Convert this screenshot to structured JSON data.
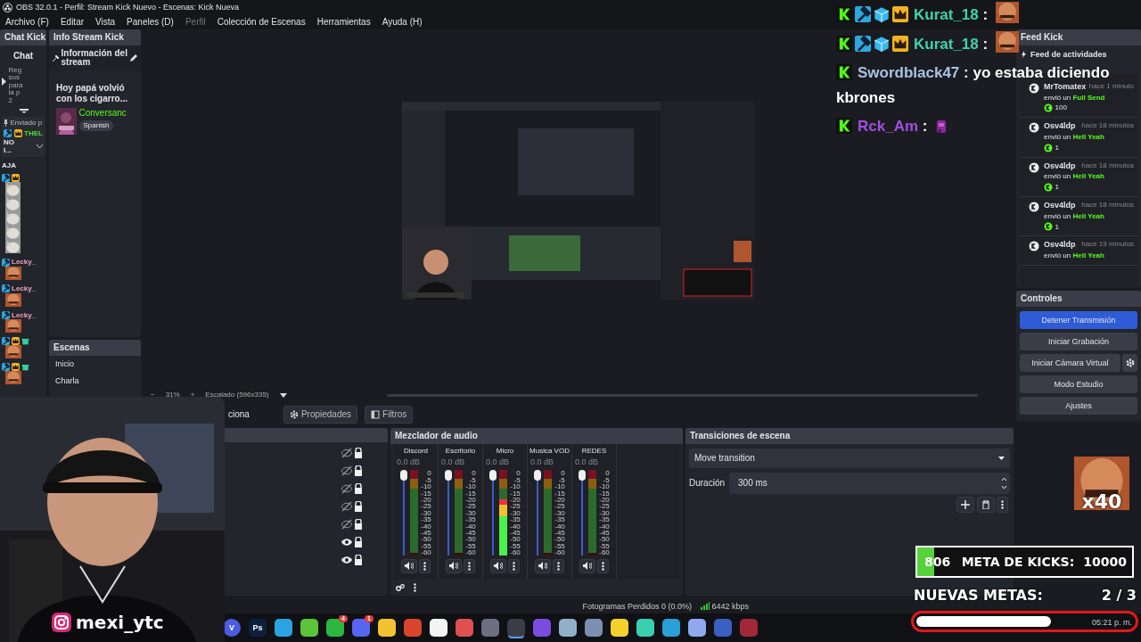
{
  "window": {
    "title": "OBS 32.0.1 - Perfil: Stream Kick Nuevo - Escenas: Kick Nueva"
  },
  "menu": [
    {
      "label": "Archivo (F)",
      "disabled": false
    },
    {
      "label": "Editar",
      "disabled": false
    },
    {
      "label": "Vista",
      "disabled": false
    },
    {
      "label": "Paneles (D)",
      "disabled": false
    },
    {
      "label": "Perfil",
      "disabled": true
    },
    {
      "label": "Colección de Escenas",
      "disabled": false
    },
    {
      "label": "Herramientas",
      "disabled": false
    },
    {
      "label": "Ayuda (H)",
      "disabled": false
    }
  ],
  "chat_dock": {
    "title": "Chat Kick",
    "header": "Chat",
    "notice": "Reg sus para la p 2",
    "pinned": {
      "label": "Enviado p",
      "badges": [
        {
          "kind": "moderator"
        },
        {
          "kind": "crown"
        }
      ],
      "user": "THEL",
      "color": "#4ade30",
      "text": "NO I..."
    },
    "messages": [
      {
        "text": "AJA"
      },
      {
        "badges": [
          {
            "kind": "moderator"
          },
          {
            "kind": "crown"
          }
        ],
        "emotes": [
          {
            "kind": "picture"
          },
          {
            "kind": "picture"
          },
          {
            "kind": "picture"
          },
          {
            "kind": "picture"
          },
          {
            "kind": "picture"
          }
        ]
      },
      {
        "badges": [
          {
            "kind": "moderator"
          }
        ],
        "user": "Lecky_",
        "color": "#f0a0c0",
        "emotes": [
          {
            "kind": "picture"
          }
        ]
      },
      {
        "badges": [
          {
            "kind": "moderator"
          }
        ],
        "user": "Lecky_",
        "color": "#f0a0c0",
        "emotes": [
          {
            "kind": "picture"
          }
        ]
      },
      {
        "badges": [
          {
            "kind": "moderator"
          }
        ],
        "user": "Lecky_",
        "color": "#f0a0c0",
        "emotes": [
          {
            "kind": "picture"
          }
        ]
      },
      {
        "badges": [
          {
            "kind": "moderator"
          },
          {
            "kind": "crown"
          },
          {
            "kind": "gift"
          }
        ],
        "emotes": [
          {
            "kind": "picture"
          }
        ]
      },
      {
        "badges": [
          {
            "kind": "moderator"
          },
          {
            "kind": "crown"
          },
          {
            "kind": "gift"
          }
        ],
        "emotes": [
          {
            "kind": "picture"
          }
        ]
      }
    ]
  },
  "info_dock": {
    "title": "Info Stream Kick",
    "header": "Información del stream",
    "stream_title": "Hoy papá volvió con los cigarro...",
    "category": "Conversanc",
    "language": "Spanish"
  },
  "scenes": {
    "title": "Escenas",
    "items": [
      {
        "label": "Inicio",
        "selected": false
      },
      {
        "label": "Charla",
        "selected": false
      }
    ]
  },
  "preview_toolbar": {
    "zoom_out": "−",
    "zoom": "31%",
    "zoom_in": "+",
    "scale": "Escalado (596x335)"
  },
  "source_toolbar": {
    "label": "ciona",
    "properties": "Propiedades",
    "filters": "Filtros"
  },
  "sources": [
    {
      "visible": false,
      "locked": true
    },
    {
      "visible": false,
      "locked": true
    },
    {
      "visible": false,
      "locked": true
    },
    {
      "visible": false,
      "locked": true
    },
    {
      "visible": false,
      "locked": true
    },
    {
      "visible": true,
      "locked": true
    },
    {
      "visible": true,
      "locked": true
    }
  ],
  "mixer": {
    "title": "Mezclador de audio",
    "channels": [
      {
        "name": "Discord",
        "reading": "0.0 dB",
        "level": 1,
        "meter": {
          "level": 0
        },
        "scale": [
          "0",
          "-5",
          "-10",
          "-15",
          "-20",
          "-25",
          "-30",
          "-35",
          "-40",
          "-45",
          "-50",
          "-55",
          "-60"
        ]
      },
      {
        "name": "Escritorio",
        "reading": "0.0 dB",
        "level": 1,
        "meter": {
          "level": 0
        },
        "scale": [
          "0",
          "-5",
          "-10",
          "-15",
          "-20",
          "-25",
          "-30",
          "-35",
          "-40",
          "-45",
          "-50",
          "-55",
          "-60"
        ]
      },
      {
        "name": "Micro",
        "reading": "0.0 dB",
        "level": 1,
        "meter": {
          "level": 0.66
        },
        "scale": [
          "0",
          "-5",
          "-10",
          "-15",
          "-20",
          "-25",
          "-30",
          "-35",
          "-40",
          "-45",
          "-50",
          "-55",
          "-60"
        ]
      },
      {
        "name": "Musica VOD",
        "reading": "0.0 dB",
        "level": 1,
        "meter": {
          "level": 0
        },
        "scale": [
          "0",
          "-5",
          "-10",
          "-15",
          "-20",
          "-25",
          "-30",
          "-35",
          "-40",
          "-45",
          "-50",
          "-55",
          "-60"
        ]
      },
      {
        "name": "REDES",
        "reading": "0.0 dB",
        "level": 1,
        "meter": {
          "level": 0
        },
        "scale": [
          "0",
          "-5",
          "-10",
          "-15",
          "-20",
          "-25",
          "-30",
          "-35",
          "-40",
          "-45",
          "-50",
          "-55",
          "-60"
        ]
      }
    ]
  },
  "transitions": {
    "title": "Transiciones de escena",
    "transition": "Move transition",
    "duration_label": "Duración",
    "duration": "300 ms"
  },
  "feed": {
    "title": "Feed Kick",
    "header": "Feed de actividades",
    "items": [
      {
        "user": "MrTomatex",
        "time": "hace 1 minuto",
        "action": "envió un",
        "gift": "Full Send",
        "amount": "100"
      },
      {
        "user": "Osv4ldp",
        "time": "hace 18 minutos",
        "action": "envió un",
        "gift": "Hell Yeah",
        "amount": "1"
      },
      {
        "user": "Osv4ldp",
        "time": "hace 18 minutos",
        "action": "envió un",
        "gift": "Hell Yeah",
        "amount": "1"
      },
      {
        "user": "Osv4ldp",
        "time": "hace 18 minutos",
        "action": "envió un",
        "gift": "Hell Yeah",
        "amount": "1"
      },
      {
        "user": "Osv4ldp",
        "time": "hace 19 minutos",
        "action": "envió un",
        "gift": "Hell Yeah"
      }
    ]
  },
  "controls": {
    "title": "Controles",
    "buttons": [
      {
        "label": "Detener Transmisión",
        "active": true
      },
      {
        "label": "Iniciar Grabación",
        "active": false
      },
      {
        "label": "Iniciar Cámara Virtual",
        "active": false,
        "settings": true
      },
      {
        "label": "Modo Estudio",
        "active": false
      },
      {
        "label": "Ajustes",
        "active": false
      }
    ]
  },
  "status_bar": {
    "dropped": "Fotogramas Perdidos 0 (0.0%)",
    "bitrate": "6442 kbps"
  },
  "taskbar": {
    "clock": "05:21 p. m.",
    "apps": [
      {
        "kind": "letter",
        "label": "V",
        "color": "#4a5ce0",
        "selected": false
      },
      {
        "kind": "letter",
        "label": "Ps",
        "color": "#0d1f3c",
        "selected": false
      },
      {
        "kind": "app",
        "color": "#2aa3e0",
        "selected": false
      },
      {
        "kind": "app",
        "color": "#5cc43a",
        "selected": false
      },
      {
        "kind": "app",
        "color": "#2bb741",
        "badge": "4",
        "selected": false
      },
      {
        "kind": "app",
        "color": "#5865f2",
        "badge": "1",
        "selected": false
      },
      {
        "kind": "app",
        "color": "#f2c230",
        "selected": false
      },
      {
        "kind": "app",
        "color": "#d9452b",
        "selected": false
      },
      {
        "kind": "app",
        "color": "#f4f4f4",
        "selected": false
      },
      {
        "kind": "app",
        "color": "#e05050",
        "selected": false
      },
      {
        "kind": "app",
        "color": "#6b6f80",
        "selected": false
      },
      {
        "kind": "app",
        "color": "#3a3d46",
        "selected": true
      },
      {
        "kind": "app",
        "color": "#7a4de0",
        "selected": false
      },
      {
        "kind": "app",
        "color": "#8fb0c8",
        "selected": false
      },
      {
        "kind": "app",
        "color": "#7d8fb0",
        "selected": false
      },
      {
        "kind": "app",
        "color": "#f6d02a",
        "selected": false
      },
      {
        "kind": "app",
        "color": "#38d0b0",
        "selected": false
      },
      {
        "kind": "app",
        "color": "#2a9fd8",
        "selected": false
      },
      {
        "kind": "app",
        "color": "#8fa8f0",
        "selected": false
      },
      {
        "kind": "app",
        "color": "#3b5fc0",
        "selected": false
      },
      {
        "kind": "app",
        "color": "#a0283a",
        "selected": false
      }
    ]
  },
  "chat_overlay": {
    "messages": [
      {
        "badges": [
          {
            "kind": "kick"
          },
          {
            "kind": "moderator"
          },
          {
            "kind": "cube"
          },
          {
            "kind": "crown"
          }
        ],
        "user": "Kurat_18",
        "color": "#3fd3a8",
        "sep": ":",
        "emote": {
          "kind": "picture"
        }
      },
      {
        "badges": [
          {
            "kind": "kick"
          },
          {
            "kind": "moderator"
          },
          {
            "kind": "cube"
          },
          {
            "kind": "crown"
          }
        ],
        "user": "Kurat_18",
        "color": "#3fd3a8",
        "sep": ":",
        "emote": {
          "kind": "picture"
        }
      },
      {
        "badges": [
          {
            "kind": "kick"
          }
        ],
        "user": "Swordblack47",
        "color": "#a9c3e6",
        "sep": ":",
        "text_lines": [
          "yo estaba diciendo",
          "kbrones"
        ]
      },
      {
        "badges": [
          {
            "kind": "kick"
          }
        ],
        "user": "Rck_Am",
        "color": "#a24de0",
        "sep": ":",
        "emote": {
          "kind": "picture"
        }
      }
    ]
  },
  "webcam": {
    "handle": "mexi_ytc"
  },
  "emote_combo": {
    "count": "x40"
  },
  "kicks_goal": {
    "current": "806",
    "label": "META DE KICKS:",
    "target": "10000",
    "level": 0.08
  },
  "new_goals": {
    "label": "NUEVAS METAS:",
    "progress": "2 / 3",
    "level": 0.62
  }
}
